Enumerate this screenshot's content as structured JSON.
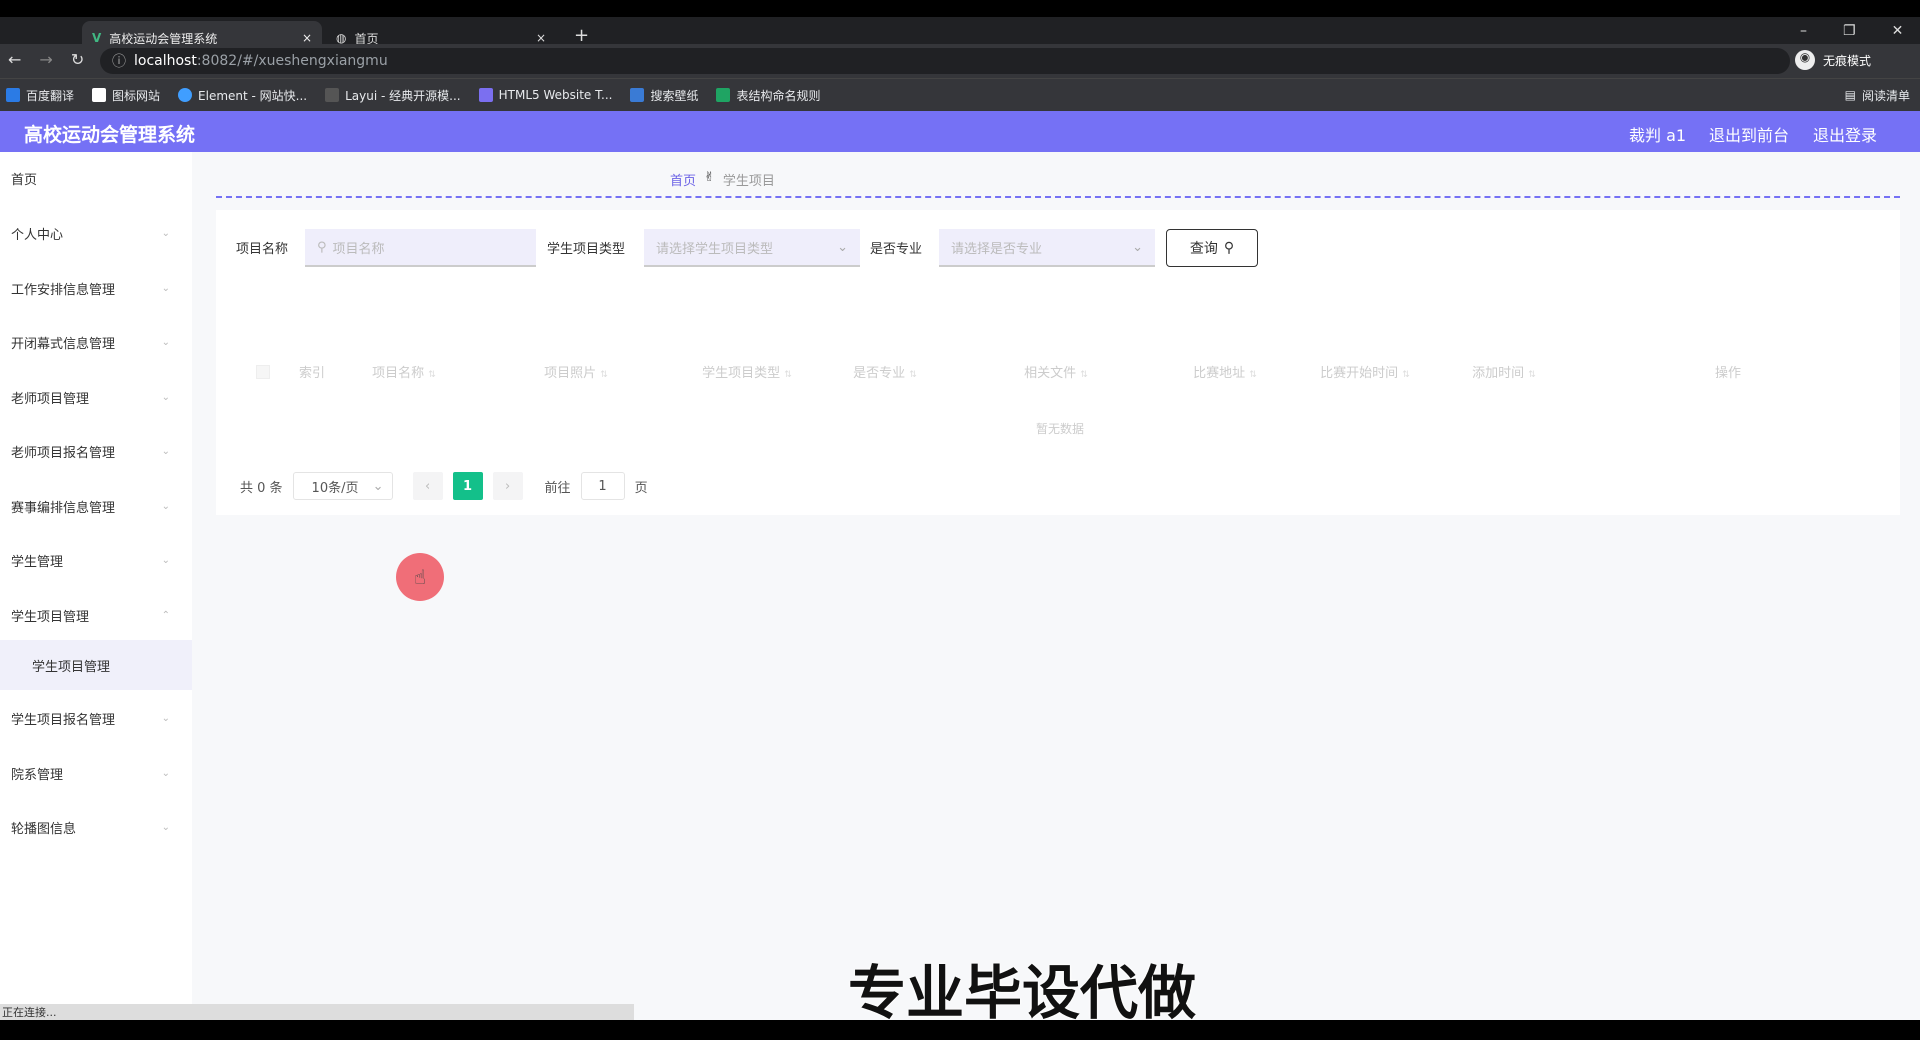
{
  "browser": {
    "tabs": [
      {
        "label": "高校运动会管理系统",
        "active": true
      },
      {
        "label": "首页",
        "active": false
      }
    ],
    "url_host": "localhost",
    "url_rest": ":8082/#/xueshengxiangmu",
    "incognito": "无痕模式",
    "bookmarks": [
      "百度翻译",
      "图标网站",
      "Element - 网站快...",
      "Layui - 经典开源模...",
      "HTML5 Website T...",
      "搜索壁纸",
      "表结构命名规则"
    ],
    "reading_list": "阅读清单",
    "status": "正在连接..."
  },
  "header": {
    "title": "高校运动会管理系统",
    "user": "裁判 a1",
    "to_front": "退出到前台",
    "logout": "退出登录",
    "color": "#7571f5"
  },
  "sidebar": {
    "items": [
      "首页",
      "个人中心",
      "工作安排信息管理",
      "开闭幕式信息管理",
      "老师项目管理",
      "老师项目报名管理",
      "赛事编排信息管理",
      "学生管理",
      "学生项目管理"
    ],
    "sub_item": "学生项目管理",
    "items_after": [
      "学生项目报名管理",
      "院系管理",
      "轮播图信息"
    ]
  },
  "breadcrumb": {
    "home": "首页",
    "current": "学生项目"
  },
  "filters": {
    "name_label": "项目名称",
    "name_placeholder": "项目名称",
    "type_label": "学生项目类型",
    "type_placeholder": "请选择学生项目类型",
    "major_label": "是否专业",
    "major_placeholder": "请选择是否专业",
    "query": "查询"
  },
  "table": {
    "columns": [
      "索引",
      "项目名称",
      "项目照片",
      "学生项目类型",
      "是否专业",
      "相关文件",
      "比赛地址",
      "比赛开始时间",
      "添加时间",
      "操作"
    ],
    "empty": "暂无数据"
  },
  "pagination": {
    "total": "共 0 条",
    "page_size": "10条/页",
    "current": "1",
    "goto": "前往",
    "goto_value": "1",
    "page_suffix": "页"
  },
  "watermark": "专业毕设代做"
}
